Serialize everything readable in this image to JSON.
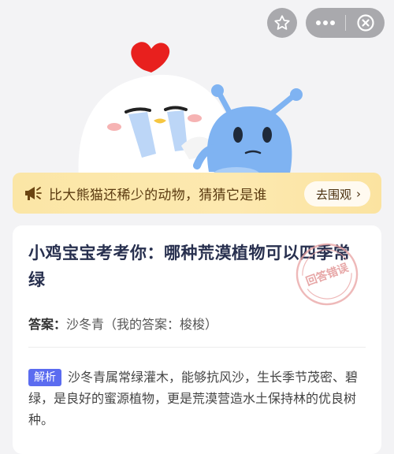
{
  "nav": {
    "star_icon": "star-outline-icon",
    "more_icon": "more-dots-icon",
    "close_icon": "close-circle-icon"
  },
  "banner": {
    "icon": "megaphone-icon",
    "text": "比大熊猫还稀少的动物，猜猜它是谁",
    "button_label": "去围观",
    "button_chevron": "›"
  },
  "question": {
    "title": "小鸡宝宝考考你：哪种荒漠植物可以四季常绿",
    "answer_label": "答案：",
    "answer_value": "沙冬青（我的答案：梭梭）",
    "stamp_text": "回答错误",
    "explain_tag": "解析",
    "explain_text": "沙冬青属常绿灌木，能够抗风沙，生长季节茂密、碧绿，是良好的蜜源植物，更是荒漠营造水土保持林的优良树种。"
  },
  "colors": {
    "stamp": "#e9a2a2",
    "tag": "#5b6cf0",
    "banner": "#fbe6a6"
  }
}
